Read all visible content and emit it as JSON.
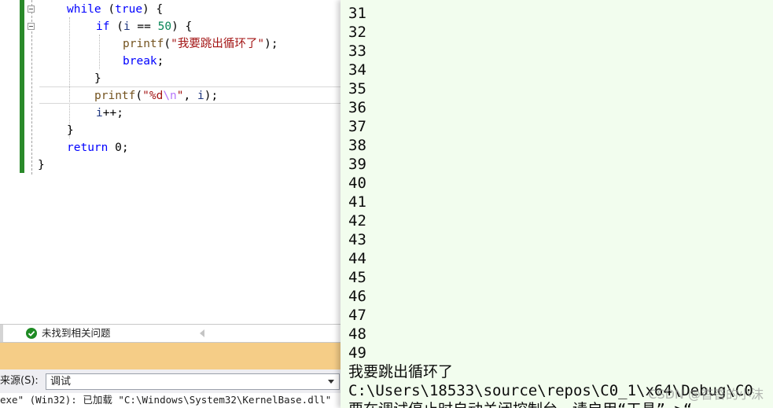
{
  "editor": {
    "lines": [
      {
        "tokens": [
          [
            "kw",
            "while"
          ],
          [
            "plain",
            " ("
          ],
          [
            "kw",
            "true"
          ],
          [
            "plain",
            ") {"
          ]
        ]
      },
      {
        "tokens": [
          [
            "kw",
            "if"
          ],
          [
            "plain",
            " ("
          ],
          [
            "var",
            "i"
          ],
          [
            "plain",
            " == "
          ],
          [
            "num",
            "50"
          ],
          [
            "plain",
            ") {"
          ]
        ]
      },
      {
        "tokens": [
          [
            "fn",
            "printf"
          ],
          [
            "plain",
            "("
          ],
          [
            "str",
            "\"我要跳出循环了\""
          ],
          [
            "plain",
            ");"
          ]
        ]
      },
      {
        "tokens": [
          [
            "kw",
            "break"
          ],
          [
            "plain",
            ";"
          ]
        ]
      },
      {
        "tokens": [
          [
            "plain",
            "}"
          ]
        ]
      },
      {
        "tokens": [
          [
            "fn",
            "printf"
          ],
          [
            "plain",
            "("
          ],
          [
            "str",
            "\"%d"
          ],
          [
            "esc",
            "\\n"
          ],
          [
            "str",
            "\""
          ],
          [
            "plain",
            ", "
          ],
          [
            "var",
            "i"
          ],
          [
            "plain",
            ");"
          ]
        ]
      },
      {
        "tokens": [
          [
            "var",
            "i"
          ],
          [
            "plain",
            "++;"
          ]
        ]
      },
      {
        "tokens": [
          [
            "plain",
            "}"
          ]
        ]
      },
      {
        "tokens": [
          [
            "kw",
            "return"
          ],
          [
            "plain",
            " 0;"
          ]
        ]
      },
      {
        "tokens": [
          [
            "plain",
            "}"
          ]
        ]
      }
    ]
  },
  "status": {
    "issues_text": "未找到相关问题"
  },
  "output": {
    "source_label": "来源(S):",
    "source_value": "调试",
    "log_line": "exe\" (Win32): 已加载 \"C:\\Windows\\System32\\KernelBase.dll\""
  },
  "console": {
    "lines": [
      "31",
      "32",
      "33",
      "34",
      "35",
      "36",
      "37",
      "38",
      "39",
      "40",
      "41",
      "42",
      "43",
      "44",
      "45",
      "46",
      "47",
      "48",
      "49",
      "我要跳出循环了",
      "C:\\Users\\18533\\source\\repos\\C0_1\\x64\\Debug\\C0",
      "要在调试停止时自动关闭控制台，请启用“工具”->“"
    ],
    "watermark": "CSDN @杳杳的小沫"
  },
  "colors": {
    "console_bg": "#f2fdee",
    "output_header": "#f5cd87",
    "change_bar": "#2a8a2a"
  }
}
